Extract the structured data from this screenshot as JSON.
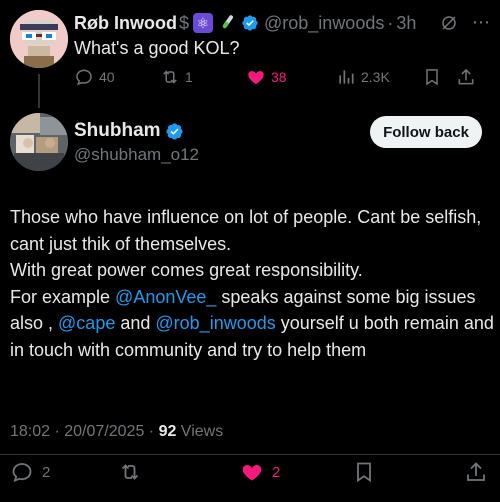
{
  "parent_tweet": {
    "author_name": "Røb Inwood",
    "author_suffix": "$",
    "emoji_1": "⚛",
    "emoji_2": "🧪",
    "handle": "@rob_inwoods",
    "separator": "·",
    "time_ago": "3h",
    "text": "What's a good KOL?",
    "replies": "40",
    "reposts": "1",
    "likes": "38",
    "views": "2.3K"
  },
  "reply_tweet": {
    "author_name": "Shubham",
    "handle": "@shubham_o12",
    "follow_label": "Follow back",
    "line1": "Those who have influence on lot of people. Cant be selfish, cant just thik of themselves.",
    "line2": "With great power comes great responsibility.",
    "line3_prefix": "For example ",
    "mention1": "@AnonVee_",
    "line3_mid": " speaks against some big issues also , ",
    "mention2": "@cape",
    "line3_and": " and ",
    "mention3": "@rob_inwoods",
    "line3_suffix": " yourself u both remain and in touch with community and try to help them",
    "timestamp": "18:02 · 20/07/2025 · ",
    "views_count": "92",
    "views_label": " Views",
    "replies": "2",
    "likes": "2"
  },
  "colors": {
    "background": "#000000",
    "text": "#e7e9ea",
    "muted": "#71767b",
    "accent_blue": "#1d9bf0",
    "like_pink": "#f91880"
  },
  "icons": [
    "reply-icon",
    "repost-icon",
    "heart-icon",
    "views-icon",
    "bookmark-icon",
    "share-icon",
    "verified-icon",
    "grok-icon",
    "more-icon"
  ]
}
